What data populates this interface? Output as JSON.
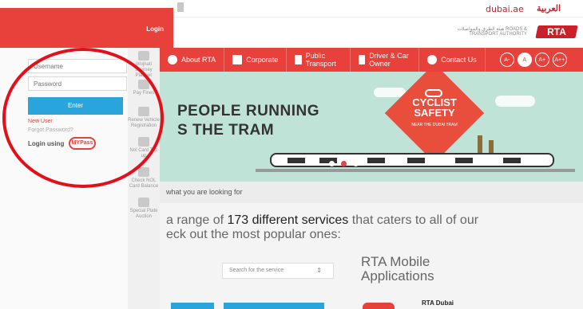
{
  "top": {
    "brand": "dubai.ae",
    "language_link": "العربية"
  },
  "header": {
    "logo_text": "RTA",
    "tagline": "هيئة الطرق والمواصلات ROADS & TRANSPORT AUTHORITY"
  },
  "nav": {
    "items": [
      {
        "label": "About RTA",
        "icon": "info-icon"
      },
      {
        "label": "Corporate",
        "icon": "briefcase-icon"
      },
      {
        "label": "Public Transport",
        "icon": "bus-icon"
      },
      {
        "label": "Driver & Car Owner",
        "icon": "car-icon"
      },
      {
        "label": "Contact Us",
        "icon": "phone-icon"
      }
    ],
    "font_sizes": [
      "A-",
      "A",
      "A+",
      "A++"
    ]
  },
  "banner": {
    "headline_line1": "PEOPLE RUNNING",
    "headline_line2": "S THE TRAM",
    "sign_title1": "CYCLIST",
    "sign_title2": "SAFETY",
    "sign_sub": "NEAR THE DUBAI TRAM"
  },
  "look_for": "what you are looking for",
  "intro": {
    "line1_pre": "a range of ",
    "highlight": "173 different services",
    "line1_post": " that caters to all of our",
    "line2": "eck out the most popular ones:"
  },
  "search_service": {
    "placeholder": "Search for the service",
    "arrow": "⇕"
  },
  "mobile": {
    "title_line1": "RTA Mobile",
    "title_line2": "Applications",
    "app_name": "RTA Dubai"
  },
  "sidebar": {
    "items": [
      {
        "label": "Wojhati Journey Planner",
        "icon": "journey-planner-icon"
      },
      {
        "label": "Pay Fines",
        "icon": "pay-fines-icon"
      },
      {
        "label": "Renew Vehicle Registration",
        "icon": "vehicle-registration-icon"
      },
      {
        "label": "Nol Card Top up",
        "icon": "nol-topup-icon"
      },
      {
        "label": "Check NOL Card Balance",
        "icon": "nol-balance-icon"
      },
      {
        "label": "Special Plate Auction",
        "icon": "plate-auction-icon"
      }
    ]
  },
  "login": {
    "title": "Login",
    "username_placeholder": "Username",
    "password_placeholder": "Password",
    "enter_label": "Enter",
    "new_user": "New User",
    "forgot_password": "Forgot Password?",
    "login_using": "Login using",
    "mypass_label": "MYPass"
  }
}
